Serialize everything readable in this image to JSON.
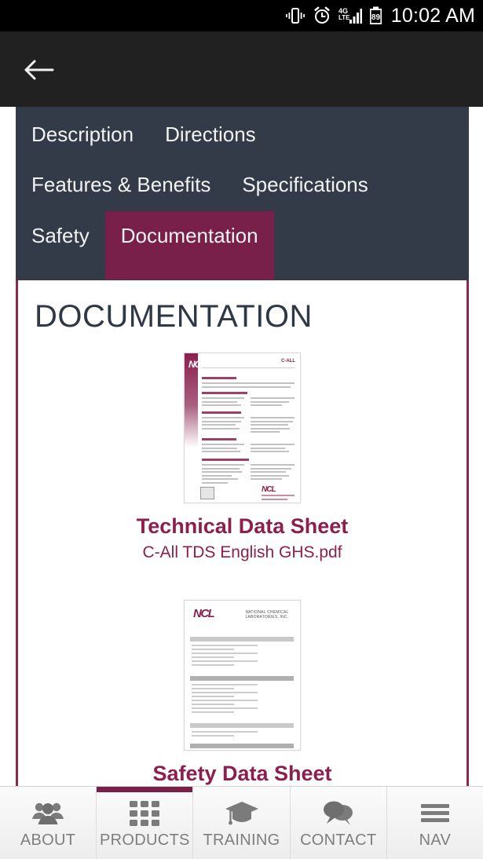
{
  "statusbar": {
    "time": "10:02 AM",
    "battery_level": "89",
    "network": "4G LTE",
    "icons": [
      "vibrate-icon",
      "alarm-icon",
      "signal-icon",
      "battery-icon"
    ]
  },
  "appbar": {
    "back_label": "back-arrow"
  },
  "tabs": [
    {
      "label": "Description",
      "active": false
    },
    {
      "label": "Directions",
      "active": false
    },
    {
      "label": "Features & Benefits",
      "active": false
    },
    {
      "label": "Specifications",
      "active": false
    },
    {
      "label": "Safety",
      "active": false
    },
    {
      "label": "Documentation",
      "active": true
    }
  ],
  "content": {
    "heading": "DOCUMENTATION",
    "documents": [
      {
        "title": "Technical Data Sheet",
        "filename": "C-All TDS English GHS.pdf",
        "thumb_logo": "NCL",
        "thumb_corner": "C-ALL"
      },
      {
        "title": "Safety Data Sheet",
        "filename": "",
        "thumb_logo": "NCL",
        "thumb_company": "NATIONAL CHEMICAL LABORATORIES, INC."
      }
    ]
  },
  "bottomnav": [
    {
      "label": "ABOUT",
      "icon": "people-icon",
      "active": false
    },
    {
      "label": "PRODUCTS",
      "icon": "grid-icon",
      "active": true
    },
    {
      "label": "TRAINING",
      "icon": "graduation-cap-icon",
      "active": false
    },
    {
      "label": "CONTACT",
      "icon": "chat-bubbles-icon",
      "active": false
    },
    {
      "label": "NAV",
      "icon": "hamburger-icon",
      "active": false
    }
  ],
  "colors": {
    "accent_maroon": "#78204a",
    "accent_maroon_text": "#8c1f4e",
    "tab_panel_dark": "#343b48",
    "appbar_dark": "#212121",
    "statusbar_black": "#000000"
  }
}
